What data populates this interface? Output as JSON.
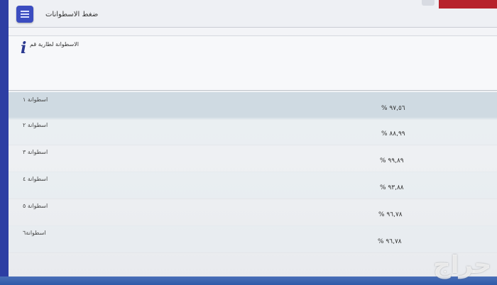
{
  "header": {
    "title": "ضغط الاسطوانات",
    "menu_icon": "menu-icon"
  },
  "info": {
    "icon": "info-icon",
    "text": "الاسطوانة لطارية قم"
  },
  "cylinders": [
    {
      "label": "اسطوانة ١",
      "value": "% ٩٧,٥٦",
      "highlighted": true
    },
    {
      "label": "اسطوانة ٢",
      "value": "% ٨٨,٩٩",
      "highlighted": false
    },
    {
      "label": "اسطوانة ٣",
      "value": "% ٩٩,٨٩",
      "highlighted": false
    },
    {
      "label": "اسطوانة ٤",
      "value": "% ٩٣,٨٨",
      "highlighted": false
    },
    {
      "label": "اسطوانة ٥",
      "value": "% ٩٦,٧٨",
      "highlighted": false
    },
    {
      "label": "اسطوانة٦",
      "value": "% ٩٦,٧٨",
      "highlighted": false
    }
  ],
  "watermark": "حراج",
  "colors": {
    "accent": "#3b4cc0",
    "row_highlight": "#cfdae2",
    "close": "#b7222c"
  }
}
